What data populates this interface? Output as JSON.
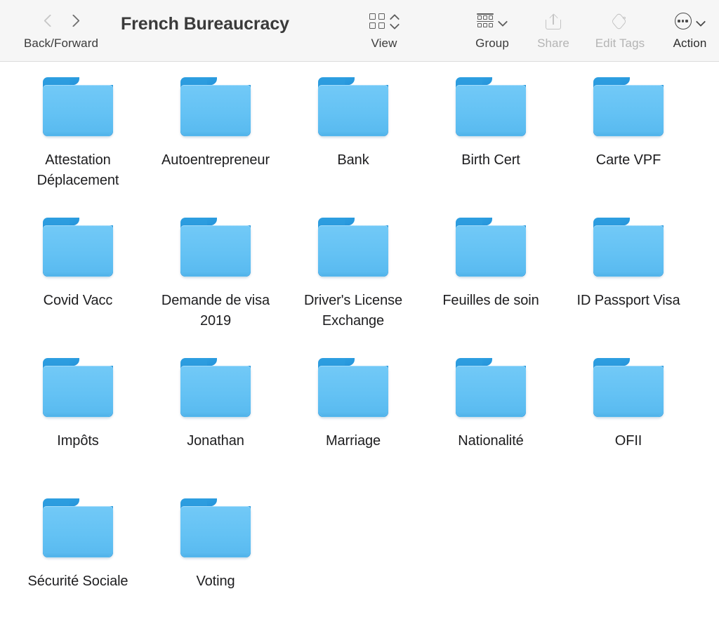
{
  "window": {
    "title": "French Bureaucracy"
  },
  "toolbar": {
    "nav": {
      "label": "Back/Forward",
      "back_icon": "chevron-left-icon",
      "forward_icon": "chevron-right-icon",
      "back_enabled": false,
      "forward_enabled": true
    },
    "items": [
      {
        "id": "view",
        "label": "View",
        "icon": "grid-view-icon",
        "chevron": "chevron-up-down-icon",
        "enabled": true
      },
      {
        "id": "group",
        "label": "Group",
        "icon": "group-rows-icon",
        "chevron": "chevron-down-icon",
        "enabled": true
      },
      {
        "id": "share",
        "label": "Share",
        "icon": "share-icon",
        "chevron": null,
        "enabled": false
      },
      {
        "id": "edit_tags",
        "label": "Edit Tags",
        "icon": "tag-icon",
        "chevron": null,
        "enabled": false
      },
      {
        "id": "action",
        "label": "Action",
        "icon": "ellipsis-circle-icon",
        "chevron": "chevron-down-icon",
        "enabled": true
      }
    ]
  },
  "colors": {
    "toolbar_background": "#f6f6f6",
    "toolbar_border": "#dcdcdc",
    "content_background": "#ffffff",
    "folder_front": "#64c2f4",
    "folder_back": "#1f8ad4",
    "label_text": "#1d1d1f",
    "toolbar_text": "#3b3b3b",
    "toolbar_text_disabled": "#b4b4b4"
  },
  "files": {
    "view_mode": "icon-grid",
    "columns": 5,
    "items": [
      {
        "name": "Attestation Déplacement",
        "kind": "folder"
      },
      {
        "name": "Autoentrepreneur",
        "kind": "folder"
      },
      {
        "name": "Bank",
        "kind": "folder"
      },
      {
        "name": "Birth Cert",
        "kind": "folder"
      },
      {
        "name": "Carte VPF",
        "kind": "folder"
      },
      {
        "name": "Covid Vacc",
        "kind": "folder"
      },
      {
        "name": "Demande de visa 2019",
        "kind": "folder"
      },
      {
        "name": "Driver's License Exchange",
        "kind": "folder"
      },
      {
        "name": "Feuilles de soin",
        "kind": "folder"
      },
      {
        "name": "ID Passport Visa",
        "kind": "folder"
      },
      {
        "name": "Impôts",
        "kind": "folder"
      },
      {
        "name": "Jonathan",
        "kind": "folder"
      },
      {
        "name": "Marriage",
        "kind": "folder"
      },
      {
        "name": "Nationalité",
        "kind": "folder"
      },
      {
        "name": "OFII",
        "kind": "folder"
      },
      {
        "name": "Sécurité Sociale",
        "kind": "folder"
      },
      {
        "name": "Voting",
        "kind": "folder"
      }
    ]
  }
}
